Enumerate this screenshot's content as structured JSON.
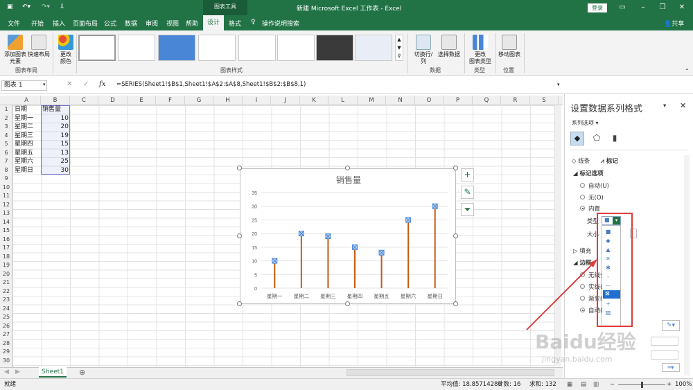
{
  "titlebar": {
    "title": "新建 Microsoft Excel 工作表 - Excel",
    "context_tab": "图表工具",
    "login": "登录",
    "colors": {
      "brand": "#217346",
      "accent_orange": "#c55a11",
      "marker_blue": "#4a86d6",
      "annotation_red": "#e13b3b"
    }
  },
  "tabs": [
    "文件",
    "开始",
    "插入",
    "页面布局",
    "公式",
    "数据",
    "审阅",
    "视图",
    "帮助",
    "设计",
    "格式"
  ],
  "active_tab": "设计",
  "tell_me": "操作说明搜索",
  "share": "共享",
  "ribbon": {
    "add_element": "添加图表\n元素",
    "quick_layout": "快速布局",
    "change_colors": "更改\n颜色",
    "switch_rowcol": "切换行/列",
    "select_data": "选择数据",
    "change_type": "更改\n图表类型",
    "move_chart": "移动图表",
    "group_layout": "图表布局",
    "group_styles": "图表样式",
    "group_data": "数据",
    "group_type": "类型",
    "group_position": "位置"
  },
  "formula_bar": {
    "namebox": "图表 1",
    "fx": "fx",
    "formula": "=SERIES(Sheet1!$B$1,Sheet1!$A$2:$A$8,Sheet1!$B$2:$B$8,1)"
  },
  "columns": [
    "A",
    "B",
    "C",
    "D",
    "E",
    "F",
    "G",
    "H",
    "I",
    "J",
    "K",
    "L",
    "M",
    "N",
    "O",
    "P",
    "Q",
    "R",
    "S"
  ],
  "rows": [
    "1",
    "2",
    "3",
    "4",
    "5",
    "6",
    "7",
    "8",
    "9",
    "10",
    "11",
    "12",
    "13",
    "14",
    "15",
    "16",
    "17",
    "18",
    "19",
    "20",
    "21",
    "22",
    "23",
    "24",
    "25",
    "26",
    "27",
    "28",
    "29",
    "30"
  ],
  "sheet": {
    "header_a": "日期",
    "header_b": "销售量",
    "data": [
      {
        "day": "星期一",
        "value": "10"
      },
      {
        "day": "星期二",
        "value": "20"
      },
      {
        "day": "星期三",
        "value": "19"
      },
      {
        "day": "星期四",
        "value": "15"
      },
      {
        "day": "星期五",
        "value": "13"
      },
      {
        "day": "星期六",
        "value": "25"
      },
      {
        "day": "星期日",
        "value": "30"
      }
    ]
  },
  "chart_data": {
    "type": "bar",
    "title": "销售量",
    "categories": [
      "星期一",
      "星期二",
      "星期三",
      "星期四",
      "星期五",
      "星期六",
      "星期日"
    ],
    "values": [
      10,
      20,
      19,
      15,
      13,
      25,
      30
    ],
    "yticks": [
      "0",
      "5",
      "10",
      "15",
      "20",
      "25",
      "30",
      "35"
    ],
    "ylim": [
      0,
      35
    ],
    "grid": true,
    "legend": "none",
    "marker": "x-square"
  },
  "pane": {
    "title": "设置数据系列格式",
    "series_options": "系列选项",
    "tab_line": "线条",
    "tab_marker": "标记",
    "marker_options": "标记选项",
    "auto": "自动(U)",
    "none": "无(O)",
    "builtin": "内置",
    "type_label": "类型",
    "size_label": "大小",
    "fill": "填充",
    "border": "边框",
    "no_line": "无线条",
    "solid_line": "实线(S)",
    "gradient_line": "渐变线",
    "auto_line": "自动(U)"
  },
  "sheet_tab": "Sheet1",
  "status": {
    "ready": "就绪",
    "average": "平均值: 18.85714286",
    "count": "计数: 16",
    "sum": "求和: 132",
    "zoom": "100%"
  },
  "watermark": "Baidu经验",
  "watermark_url": "jingyan.baidu.com"
}
